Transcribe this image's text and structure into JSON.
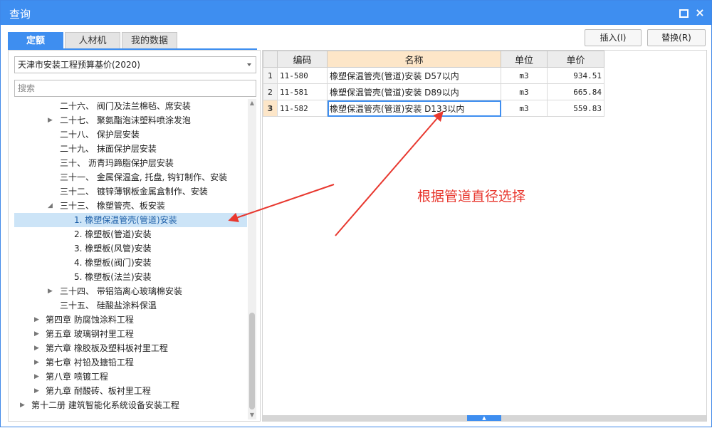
{
  "window": {
    "title": "查询",
    "maximize_glyph": "",
    "close_glyph": "×"
  },
  "tabs": [
    {
      "label": "定额",
      "active": true
    },
    {
      "label": "人材机",
      "active": false
    },
    {
      "label": "我的数据",
      "active": false
    }
  ],
  "toolbar": {
    "insert_label": "插入(I)",
    "replace_label": "替换(R)"
  },
  "left": {
    "library": "天津市安装工程预算基价(2020)",
    "search_placeholder": "搜索",
    "tree": [
      {
        "label": "二十六、 阀门及法兰棉毡、席安装",
        "has_arrow": false
      },
      {
        "label": "二十七、 聚氨酯泡沫塑料喷涂发泡",
        "has_arrow": true
      },
      {
        "label": "二十八、 保护层安装",
        "has_arrow": false
      },
      {
        "label": "二十九、 抹面保护层安装",
        "has_arrow": false
      },
      {
        "label": "三十、 沥青玛蹄脂保护层安装",
        "has_arrow": false
      },
      {
        "label": "三十一、 金属保温盒, 托盘, 钩钉制作、安装",
        "has_arrow": false
      },
      {
        "label": "三十二、 镀锌薄钢板金属盒制作、安装",
        "has_arrow": false
      },
      {
        "label": "三十三、 橡塑管壳、板安装",
        "has_arrow": true,
        "expanded": true
      },
      {
        "label": "1. 橡塑保温管壳(管道)安装",
        "has_arrow": false,
        "selected": true
      },
      {
        "label": "2. 橡塑板(管道)安装",
        "has_arrow": false
      },
      {
        "label": "3. 橡塑板(风管)安装",
        "has_arrow": false
      },
      {
        "label": "4. 橡塑板(阀门)安装",
        "has_arrow": false
      },
      {
        "label": "5. 橡塑板(法兰)安装",
        "has_arrow": false
      },
      {
        "label": "三十四、 带铝箔离心玻璃棉安装",
        "has_arrow": true
      },
      {
        "label": "三十五、 硅酸盐涂料保温",
        "has_arrow": false
      },
      {
        "label": "第四章 防腐蚀涂料工程",
        "has_arrow": true
      },
      {
        "label": "第五章 玻璃钢衬里工程",
        "has_arrow": true
      },
      {
        "label": "第六章 橡胶板及塑料板衬里工程",
        "has_arrow": true
      },
      {
        "label": "第七章 衬铅及搪铅工程",
        "has_arrow": true
      },
      {
        "label": "第八章 喷镀工程",
        "has_arrow": true
      },
      {
        "label": "第九章 耐酸砖、板衬里工程",
        "has_arrow": true
      },
      {
        "label": "第十二册 建筑智能化系统设备安装工程",
        "has_arrow": true
      }
    ]
  },
  "grid": {
    "columns": [
      "编码",
      "名称",
      "单位",
      "单价"
    ],
    "rows": [
      {
        "num": "1",
        "code": "11-580",
        "name": "橡塑保温管壳(管道)安装 D57以内",
        "unit": "m3",
        "price": "934.51"
      },
      {
        "num": "2",
        "code": "11-581",
        "name": "橡塑保温管壳(管道)安装 D89以内",
        "unit": "m3",
        "price": "665.84"
      },
      {
        "num": "3",
        "code": "11-582",
        "name": "橡塑保温管壳(管道)安装 D133以内",
        "unit": "m3",
        "price": "559.83"
      }
    ]
  },
  "annotation": {
    "text": "根据管道直径选择",
    "color": "#e8382f"
  },
  "colors": {
    "accent": "#3e8ef0",
    "header_highlight": "#fde6c8",
    "selected_row": "#cce4f7"
  }
}
